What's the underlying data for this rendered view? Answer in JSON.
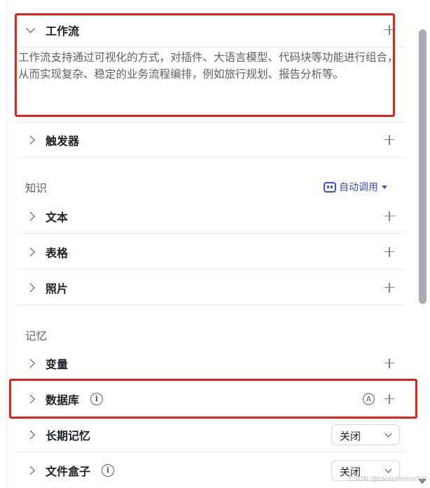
{
  "workflow": {
    "title": "工作流",
    "description": "工作流支持通过可视化的方式，对插件、大语言模型、代码块等功能进行组合，从而实现复杂、稳定的业务流程编排，例如旅行规划、报告分析等。"
  },
  "trigger": {
    "title": "触发器"
  },
  "knowledge": {
    "section_label": "知识",
    "auto_call_label": "自动调用",
    "items": [
      {
        "title": "文本"
      },
      {
        "title": "表格"
      },
      {
        "title": "照片"
      }
    ]
  },
  "memory": {
    "section_label": "记忆",
    "items": {
      "variable": {
        "title": "变量"
      },
      "database": {
        "title": "数据库",
        "info_icon": "i",
        "badge": "A"
      },
      "long_term": {
        "title": "长期记忆",
        "select_value": "关闭"
      },
      "file_box": {
        "title": "文件盒子",
        "info_icon": "i",
        "select_value": "关闭"
      }
    }
  },
  "watermark": "CSDN @taoismimortal",
  "colors": {
    "highlight": "#e2231a",
    "accent": "#3a4fd6",
    "divider": "#e9ebef"
  }
}
